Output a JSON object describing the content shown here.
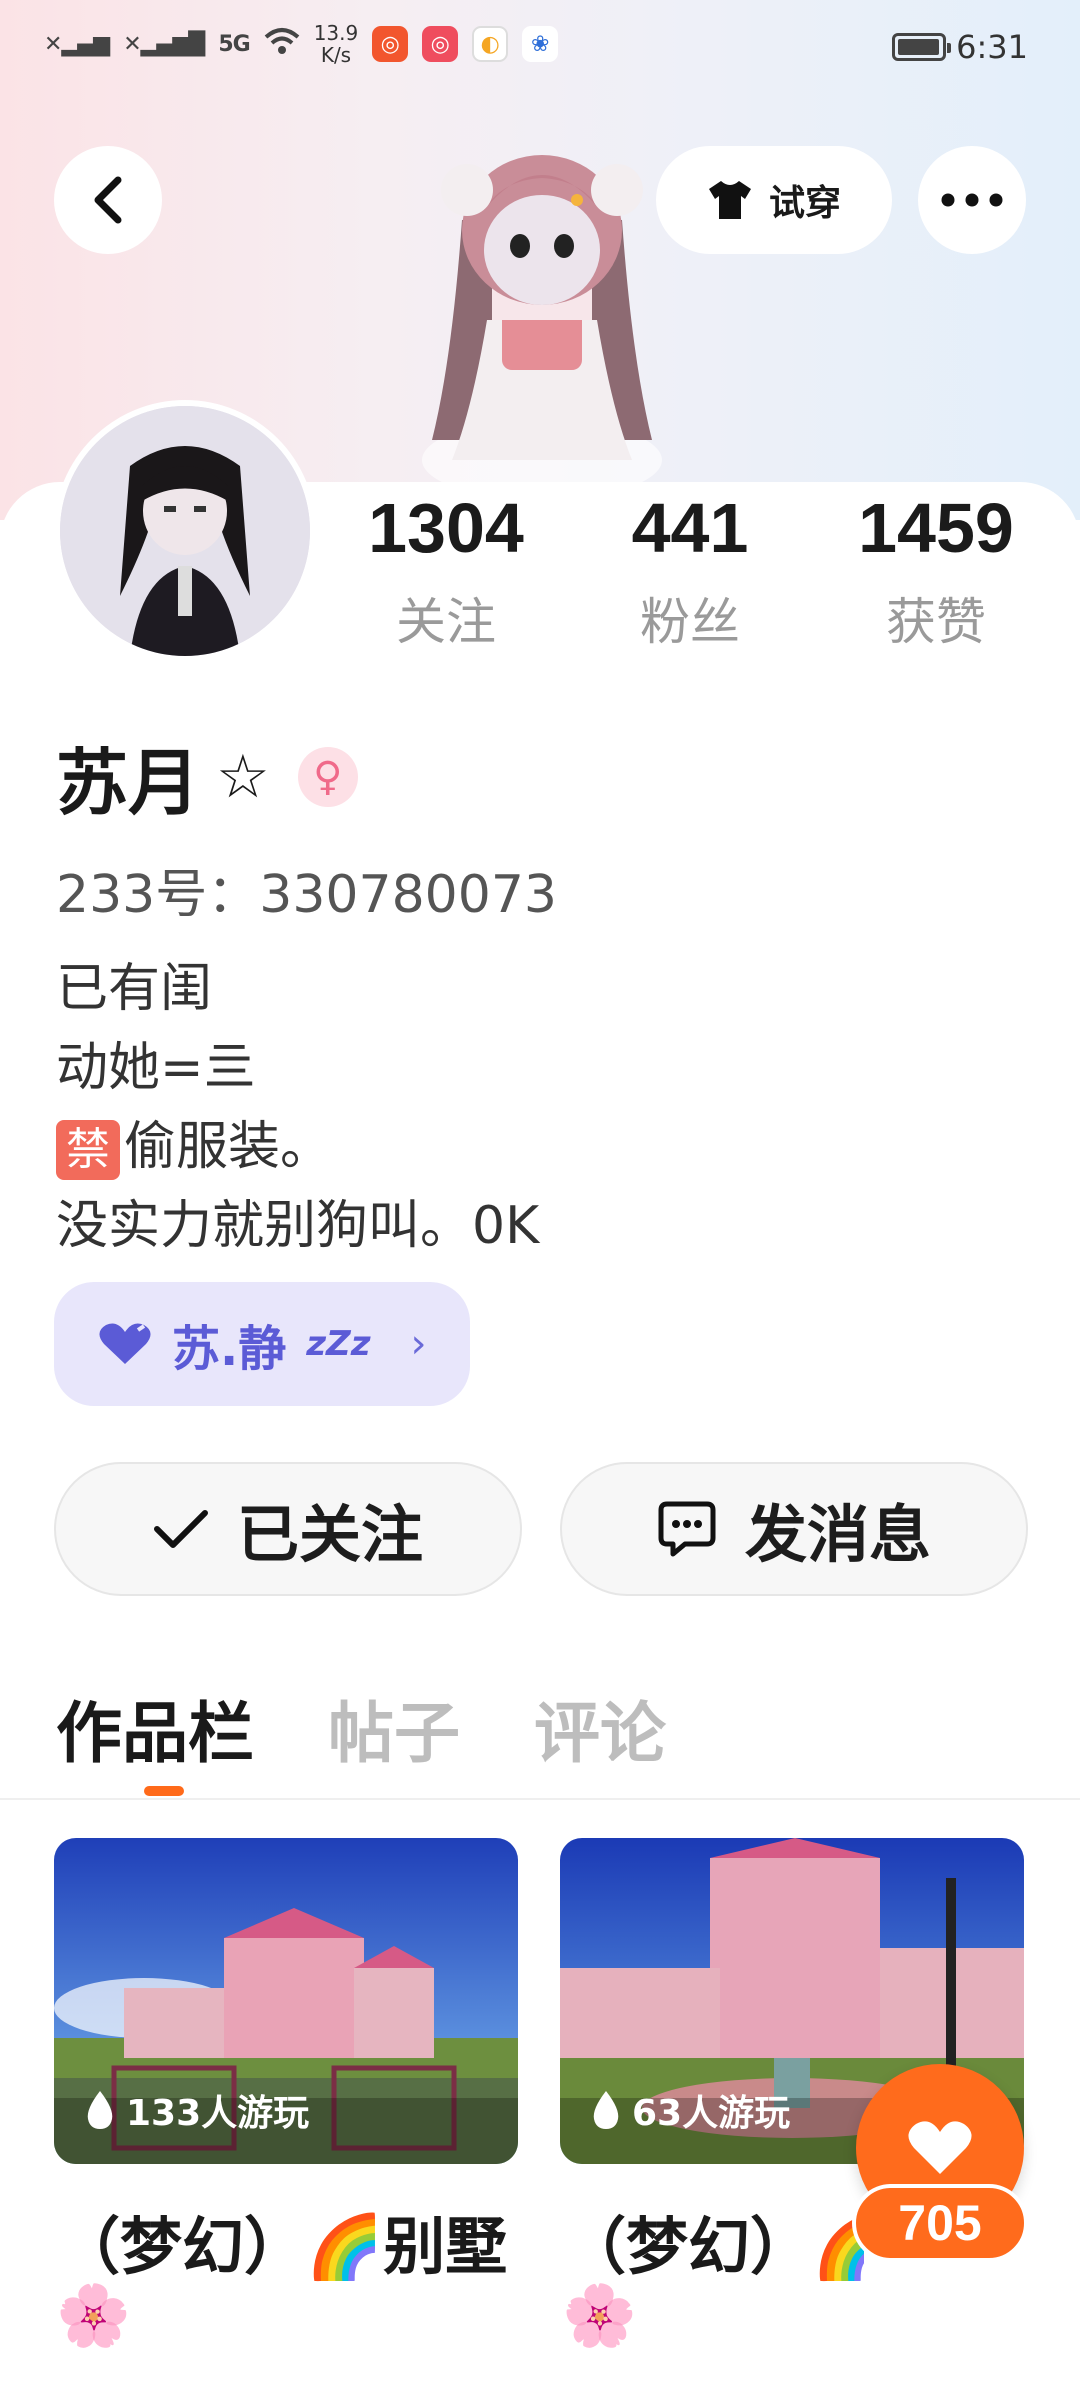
{
  "status_bar": {
    "signal_1": "✕",
    "signal_2": "✕",
    "net": "5G",
    "speed_value": "13.9",
    "speed_unit": "K/s",
    "time": "6:31",
    "battery_percent": 85
  },
  "header": {
    "try_on_label": "试穿"
  },
  "stats": {
    "following_count": "1304",
    "following_label": "关注",
    "fans_count": "441",
    "fans_label": "粉丝",
    "likes_count": "1459",
    "likes_label": "获赞"
  },
  "profile": {
    "name": "苏月",
    "name_star": "☆",
    "gender_symbol": "♀",
    "uid_text": "233号：330780073",
    "bio_line_1": "已有闺",
    "bio_line_2": "动她=亖",
    "bio_ban_char": "禁",
    "bio_line_3": "偷服装。",
    "bio_line_4": "没实力就别狗叫。0K"
  },
  "companion": {
    "name": "苏.静",
    "sleep": "zZz",
    "chevron": "›"
  },
  "actions": {
    "followed_label": "已关注",
    "message_label": "发消息"
  },
  "tabs": [
    {
      "label": "作品栏"
    },
    {
      "label": "帖子"
    },
    {
      "label": "评论"
    }
  ],
  "works": [
    {
      "players": "133人游玩",
      "title": "（梦幻）🌈别墅",
      "flower": "🌸"
    },
    {
      "players": "63人游玩",
      "title": "（梦幻）🌈",
      "flower": "🌸"
    }
  ],
  "like_button": {
    "count": "705"
  },
  "colors": {
    "accent_orange": "#ff6b1c",
    "companion_bg": "#e8e6fb",
    "companion_text": "#5b5bd6"
  }
}
